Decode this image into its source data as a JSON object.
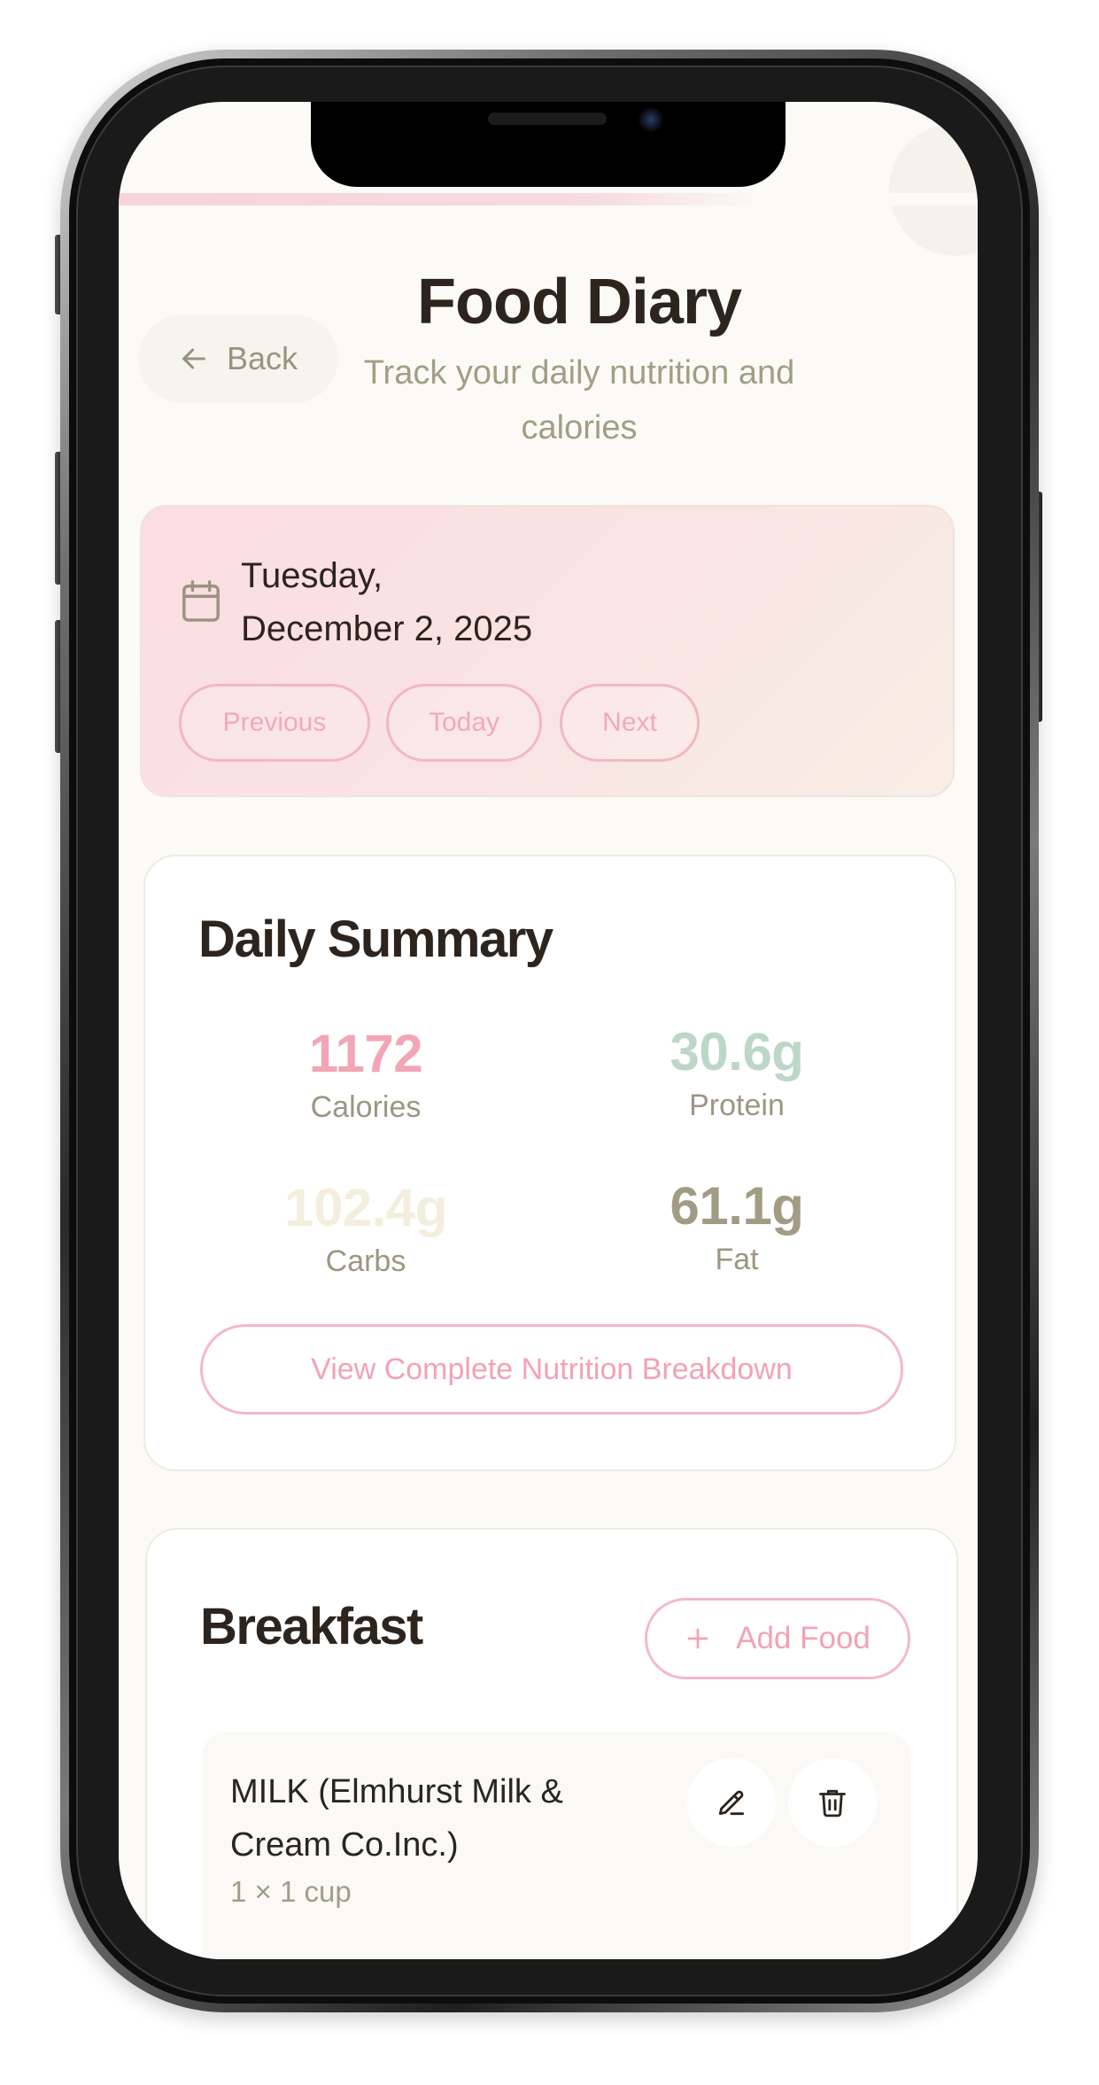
{
  "header": {
    "back_label": "Back",
    "title": "Food Diary",
    "subtitle": "Track your daily nutrition and calories"
  },
  "date_card": {
    "date_line1": "Tuesday,",
    "date_line2": "December 2, 2025",
    "buttons": {
      "previous": "Previous",
      "today": "Today",
      "next": "Next"
    }
  },
  "summary": {
    "title": "Daily Summary",
    "calories": {
      "value": "1172",
      "label": "Calories",
      "color": "#f2a5b5"
    },
    "protein": {
      "value": "30.6g",
      "label": "Protein",
      "color": "#bcd7c6"
    },
    "carbs": {
      "value": "102.4g",
      "label": "Carbs",
      "color": "#f4eedf"
    },
    "fat": {
      "value": "61.1g",
      "label": "Fat",
      "color": "#a39c84"
    },
    "breakdown_button": "View Complete Nutrition Breakdown"
  },
  "breakfast": {
    "title": "Breakfast",
    "add_food_label": "Add Food",
    "items": [
      {
        "name": "MILK (Elmhurst Milk & Cream Co.Inc.)",
        "serving": "1 × 1 cup",
        "edit_icon": "pencil-icon",
        "delete_icon": "trash-icon"
      }
    ]
  },
  "colors": {
    "accent_pink": "#f2a5b5",
    "text_dark": "#2d241e",
    "text_muted": "#a49d84"
  }
}
